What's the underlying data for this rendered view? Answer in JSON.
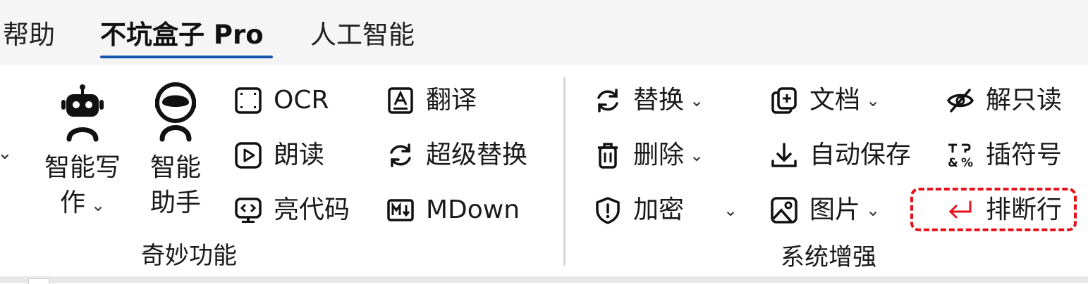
{
  "tabs": [
    {
      "label": "帮助",
      "active": false
    },
    {
      "label": "不坑盒子 Pro",
      "active": true
    },
    {
      "label": "人工智能",
      "active": false
    }
  ],
  "accent_color": "#1a56b0",
  "highlight_color": "#e8101a",
  "groups": {
    "magic": {
      "label": "奇妙功能",
      "big_buttons": [
        {
          "line1": "智能写",
          "line2": "作",
          "icon": "robot-icon",
          "has_dropdown": true
        },
        {
          "line1": "智能",
          "line2": "助手",
          "icon": "astronaut-icon",
          "has_dropdown": false
        }
      ],
      "small_buttons": [
        {
          "label": "OCR",
          "icon": "scan-frame-icon"
        },
        {
          "label": "朗读",
          "icon": "play-icon"
        },
        {
          "label": "亮代码",
          "icon": "code-monitor-icon"
        },
        {
          "label": "翻译",
          "icon": "translate-icon"
        },
        {
          "label": "超级替换",
          "icon": "refresh-icon"
        },
        {
          "label": "MDown",
          "icon": "markdown-icon"
        }
      ]
    },
    "system": {
      "label": "系统增强",
      "buttons": [
        {
          "label": "替换",
          "icon": "replace-icon",
          "has_dropdown": true
        },
        {
          "label": "删除",
          "icon": "trash-icon",
          "has_dropdown": true
        },
        {
          "label": "加密",
          "icon": "shield-icon",
          "has_dropdown": true
        },
        {
          "label": "文档",
          "icon": "add-document-icon",
          "has_dropdown": true
        },
        {
          "label": "自动保存",
          "icon": "download-icon",
          "has_dropdown": false
        },
        {
          "label": "图片",
          "icon": "image-icon",
          "has_dropdown": true
        },
        {
          "label": "解只读",
          "icon": "eye-off-icon",
          "has_dropdown": false
        },
        {
          "label": "插符号",
          "icon": "symbols-icon",
          "has_dropdown": false
        },
        {
          "label": "排断行",
          "icon": "enter-arrow-icon",
          "has_dropdown": false,
          "highlighted": true
        }
      ]
    }
  },
  "caret_glyph": "⌄",
  "left_caret_glyph": "⌄"
}
